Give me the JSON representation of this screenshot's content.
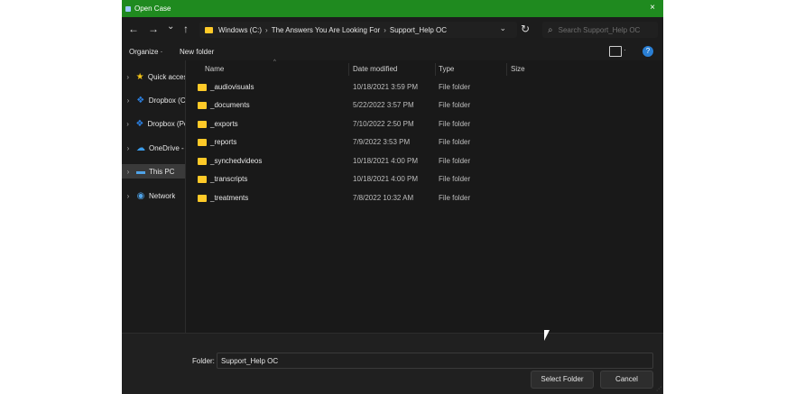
{
  "window": {
    "title": "Open Case",
    "close_glyph": "×"
  },
  "nav": {
    "back_icon": "←",
    "forward_icon": "→",
    "recent_icon": "⌄",
    "up_icon": "↑",
    "breadcrumb": [
      "Windows (C:)",
      "The Answers You Are Looking For",
      "Support_Help OC"
    ],
    "breadcrumb_sep": "›",
    "address_dropdown": "⌄",
    "refresh_icon": "↻",
    "search_placeholder": "Search Support_Help OC"
  },
  "toolbar": {
    "organize": "Organize ·",
    "new_folder": "New folder",
    "view_dropdown": "·",
    "help": "?"
  },
  "sidebar": {
    "items": [
      {
        "label": "Quick acces",
        "icon": "star-icon",
        "glyph": "★",
        "color": "#f5c518",
        "selected": false
      },
      {
        "label": "Dropbox (C",
        "icon": "dropbox-icon",
        "glyph": "❖",
        "color": "#2b7fe0",
        "selected": false
      },
      {
        "label": "Dropbox (Pe",
        "icon": "dropbox-icon",
        "glyph": "❖",
        "color": "#2b7fe0",
        "selected": false
      },
      {
        "label": "OneDrive - ",
        "icon": "onedrive-icon",
        "glyph": "☁",
        "color": "#3a9ae8",
        "selected": false
      },
      {
        "label": "This PC",
        "icon": "computer-icon",
        "glyph": "▬",
        "color": "#4fa3e8",
        "selected": true
      },
      {
        "label": "Network",
        "icon": "network-icon",
        "glyph": "◉",
        "color": "#4fa3e8",
        "selected": false
      }
    ],
    "chevron": "›"
  },
  "columns": {
    "name": "Name",
    "date": "Date modified",
    "type": "Type",
    "size": "Size",
    "sort_caret": "^"
  },
  "files": [
    {
      "name": "_audiovisuals",
      "date": "10/18/2021 3:59 PM",
      "type": "File folder",
      "size": ""
    },
    {
      "name": "_documents",
      "date": "5/22/2022 3:57 PM",
      "type": "File folder",
      "size": ""
    },
    {
      "name": "_exports",
      "date": "7/10/2022 2:50 PM",
      "type": "File folder",
      "size": ""
    },
    {
      "name": "_reports",
      "date": "7/9/2022 3:53 PM",
      "type": "File folder",
      "size": ""
    },
    {
      "name": "_synchedvideos",
      "date": "10/18/2021 4:00 PM",
      "type": "File folder",
      "size": ""
    },
    {
      "name": "_transcripts",
      "date": "10/18/2021 4:00 PM",
      "type": "File folder",
      "size": ""
    },
    {
      "name": "_treatments",
      "date": "7/8/2022 10:32 AM",
      "type": "File folder",
      "size": ""
    }
  ],
  "footer": {
    "folder_label": "Folder:",
    "folder_value": "Support_Help OC",
    "select_button": "Select Folder",
    "cancel_button": "Cancel"
  },
  "colors": {
    "accent_titlebar": "#1f8a1f",
    "folder": "#ffca28",
    "background": "#191919"
  }
}
